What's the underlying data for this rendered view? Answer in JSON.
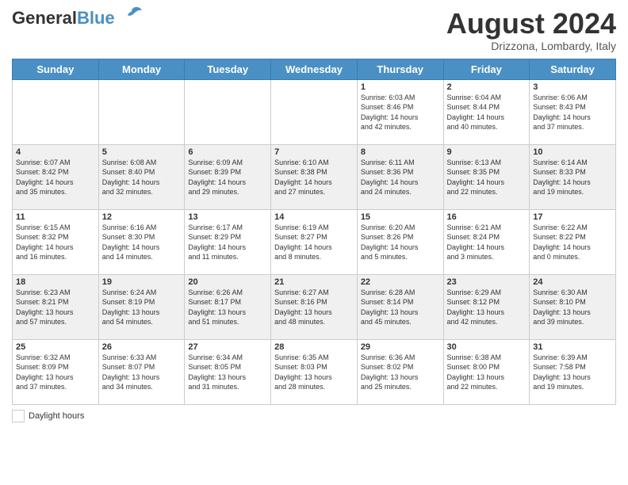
{
  "header": {
    "logo_general": "General",
    "logo_blue": "Blue",
    "month_title": "August 2024",
    "location": "Drizzona, Lombardy, Italy"
  },
  "weekdays": [
    "Sunday",
    "Monday",
    "Tuesday",
    "Wednesday",
    "Thursday",
    "Friday",
    "Saturday"
  ],
  "legend": {
    "label": "Daylight hours"
  },
  "weeks": [
    [
      {
        "day": "",
        "info": ""
      },
      {
        "day": "",
        "info": ""
      },
      {
        "day": "",
        "info": ""
      },
      {
        "day": "",
        "info": ""
      },
      {
        "day": "1",
        "info": "Sunrise: 6:03 AM\nSunset: 8:46 PM\nDaylight: 14 hours\nand 42 minutes."
      },
      {
        "day": "2",
        "info": "Sunrise: 6:04 AM\nSunset: 8:44 PM\nDaylight: 14 hours\nand 40 minutes."
      },
      {
        "day": "3",
        "info": "Sunrise: 6:06 AM\nSunset: 8:43 PM\nDaylight: 14 hours\nand 37 minutes."
      }
    ],
    [
      {
        "day": "4",
        "info": "Sunrise: 6:07 AM\nSunset: 8:42 PM\nDaylight: 14 hours\nand 35 minutes."
      },
      {
        "day": "5",
        "info": "Sunrise: 6:08 AM\nSunset: 8:40 PM\nDaylight: 14 hours\nand 32 minutes."
      },
      {
        "day": "6",
        "info": "Sunrise: 6:09 AM\nSunset: 8:39 PM\nDaylight: 14 hours\nand 29 minutes."
      },
      {
        "day": "7",
        "info": "Sunrise: 6:10 AM\nSunset: 8:38 PM\nDaylight: 14 hours\nand 27 minutes."
      },
      {
        "day": "8",
        "info": "Sunrise: 6:11 AM\nSunset: 8:36 PM\nDaylight: 14 hours\nand 24 minutes."
      },
      {
        "day": "9",
        "info": "Sunrise: 6:13 AM\nSunset: 8:35 PM\nDaylight: 14 hours\nand 22 minutes."
      },
      {
        "day": "10",
        "info": "Sunrise: 6:14 AM\nSunset: 8:33 PM\nDaylight: 14 hours\nand 19 minutes."
      }
    ],
    [
      {
        "day": "11",
        "info": "Sunrise: 6:15 AM\nSunset: 8:32 PM\nDaylight: 14 hours\nand 16 minutes."
      },
      {
        "day": "12",
        "info": "Sunrise: 6:16 AM\nSunset: 8:30 PM\nDaylight: 14 hours\nand 14 minutes."
      },
      {
        "day": "13",
        "info": "Sunrise: 6:17 AM\nSunset: 8:29 PM\nDaylight: 14 hours\nand 11 minutes."
      },
      {
        "day": "14",
        "info": "Sunrise: 6:19 AM\nSunset: 8:27 PM\nDaylight: 14 hours\nand 8 minutes."
      },
      {
        "day": "15",
        "info": "Sunrise: 6:20 AM\nSunset: 8:26 PM\nDaylight: 14 hours\nand 5 minutes."
      },
      {
        "day": "16",
        "info": "Sunrise: 6:21 AM\nSunset: 8:24 PM\nDaylight: 14 hours\nand 3 minutes."
      },
      {
        "day": "17",
        "info": "Sunrise: 6:22 AM\nSunset: 8:22 PM\nDaylight: 14 hours\nand 0 minutes."
      }
    ],
    [
      {
        "day": "18",
        "info": "Sunrise: 6:23 AM\nSunset: 8:21 PM\nDaylight: 13 hours\nand 57 minutes."
      },
      {
        "day": "19",
        "info": "Sunrise: 6:24 AM\nSunset: 8:19 PM\nDaylight: 13 hours\nand 54 minutes."
      },
      {
        "day": "20",
        "info": "Sunrise: 6:26 AM\nSunset: 8:17 PM\nDaylight: 13 hours\nand 51 minutes."
      },
      {
        "day": "21",
        "info": "Sunrise: 6:27 AM\nSunset: 8:16 PM\nDaylight: 13 hours\nand 48 minutes."
      },
      {
        "day": "22",
        "info": "Sunrise: 6:28 AM\nSunset: 8:14 PM\nDaylight: 13 hours\nand 45 minutes."
      },
      {
        "day": "23",
        "info": "Sunrise: 6:29 AM\nSunset: 8:12 PM\nDaylight: 13 hours\nand 42 minutes."
      },
      {
        "day": "24",
        "info": "Sunrise: 6:30 AM\nSunset: 8:10 PM\nDaylight: 13 hours\nand 39 minutes."
      }
    ],
    [
      {
        "day": "25",
        "info": "Sunrise: 6:32 AM\nSunset: 8:09 PM\nDaylight: 13 hours\nand 37 minutes."
      },
      {
        "day": "26",
        "info": "Sunrise: 6:33 AM\nSunset: 8:07 PM\nDaylight: 13 hours\nand 34 minutes."
      },
      {
        "day": "27",
        "info": "Sunrise: 6:34 AM\nSunset: 8:05 PM\nDaylight: 13 hours\nand 31 minutes."
      },
      {
        "day": "28",
        "info": "Sunrise: 6:35 AM\nSunset: 8:03 PM\nDaylight: 13 hours\nand 28 minutes."
      },
      {
        "day": "29",
        "info": "Sunrise: 6:36 AM\nSunset: 8:02 PM\nDaylight: 13 hours\nand 25 minutes."
      },
      {
        "day": "30",
        "info": "Sunrise: 6:38 AM\nSunset: 8:00 PM\nDaylight: 13 hours\nand 22 minutes."
      },
      {
        "day": "31",
        "info": "Sunrise: 6:39 AM\nSunset: 7:58 PM\nDaylight: 13 hours\nand 19 minutes."
      }
    ]
  ]
}
